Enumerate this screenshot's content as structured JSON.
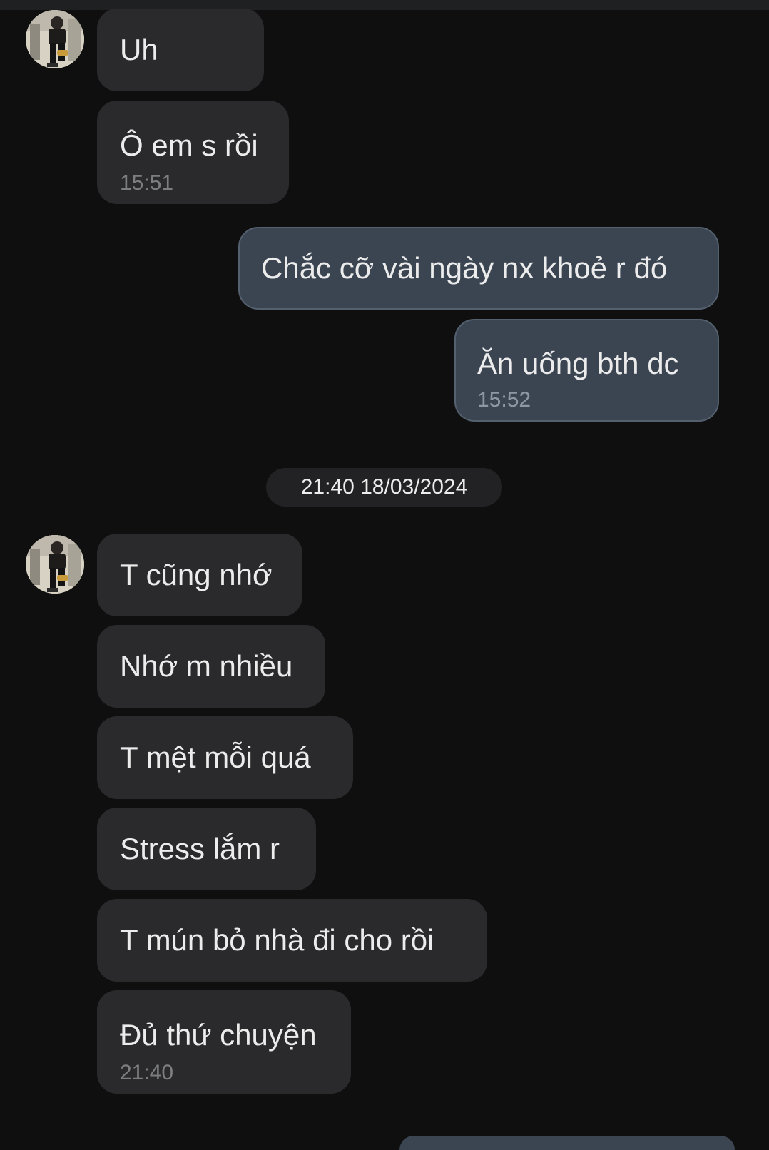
{
  "messages": [
    {
      "side": "in",
      "text": "Uh"
    },
    {
      "side": "in",
      "text": "Ô em s rồi",
      "time": "15:51"
    },
    {
      "side": "out",
      "text": "Chắc cỡ vài ngày nx khoẻ r đó"
    },
    {
      "side": "out",
      "text": "Ăn uống bth dc",
      "time": "15:52"
    },
    {
      "side": "in",
      "text": "T cũng nhớ"
    },
    {
      "side": "in",
      "text": "Nhớ m nhiều"
    },
    {
      "side": "in",
      "text": "T mệt mỗi quá"
    },
    {
      "side": "in",
      "text": "Stress lắm r"
    },
    {
      "side": "in",
      "text": "T mún bỏ nhà đi cho rồi"
    },
    {
      "side": "in",
      "text": "Đủ thứ chuyện",
      "time": "21:40"
    }
  ],
  "date_separator": "21:40 18/03/2024",
  "colors": {
    "background": "#0f0f10",
    "incoming_bubble": "#2a2a2c",
    "outgoing_bubble": "#3b4552",
    "outgoing_border": "#54606e",
    "timestamp": "#7d7e82"
  },
  "icons": {
    "avatar": "contact-avatar-photo"
  }
}
